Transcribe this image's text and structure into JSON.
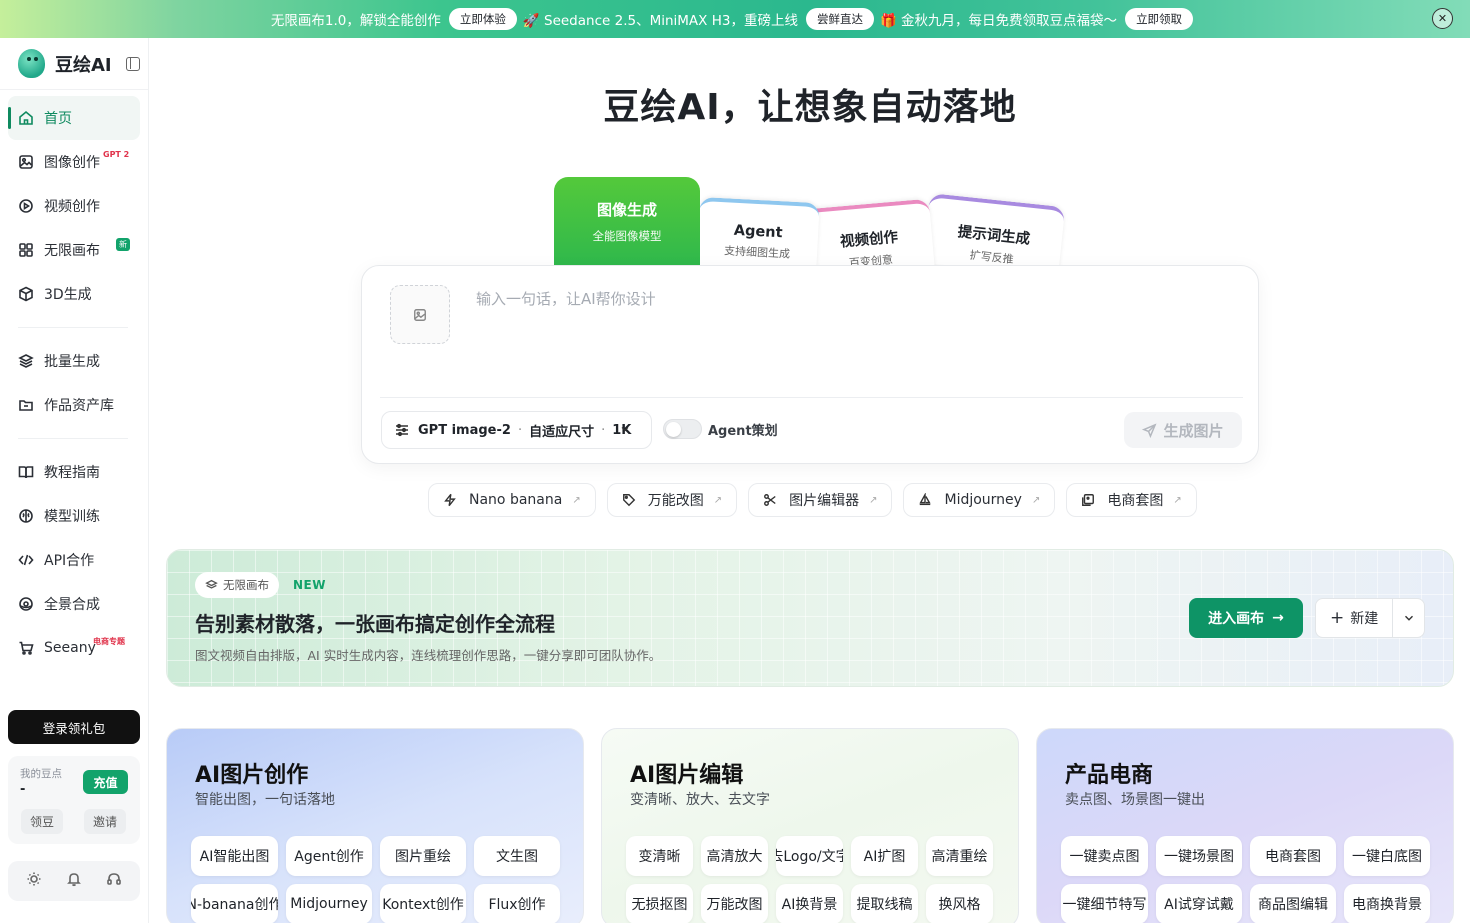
{
  "banner": {
    "seg1_text": "无限画布1.0，解锁全能创作",
    "seg1_btn": "立即体验",
    "seg2_text": "🚀 Seedance 2.5、MiniMAX H3，重磅上线",
    "seg2_btn": "尝鲜直达",
    "seg3_text": "🎁 金秋九月，每日免费领取豆点福袋～",
    "seg3_btn": "立即领取",
    "close_icon": "close-icon"
  },
  "sidebar": {
    "logo_text": "豆绘AI",
    "items": [
      {
        "label": "首页",
        "icon": "home-icon"
      },
      {
        "label": "图像创作",
        "icon": "image-icon",
        "tag": "GPT 2"
      },
      {
        "label": "视频创作",
        "icon": "play-icon"
      },
      {
        "label": "无限画布",
        "icon": "grid-icon",
        "tag": "新"
      },
      {
        "label": "3D生成",
        "icon": "cube-icon"
      },
      {
        "label": "批量生成",
        "icon": "layers-icon"
      },
      {
        "label": "作品资产库",
        "icon": "folder-icon"
      },
      {
        "label": "教程指南",
        "icon": "book-icon"
      },
      {
        "label": "模型训练",
        "icon": "brain-icon"
      },
      {
        "label": "API合作",
        "icon": "code-icon"
      },
      {
        "label": "全景合成",
        "icon": "panorama-icon"
      },
      {
        "label": "Seeany",
        "icon": "cart-icon",
        "tag": "电商专题"
      }
    ],
    "login_label": "登录领礼包",
    "points_label": "我的豆点",
    "points_value": "-",
    "recharge_label": "充值",
    "collect_label": "领豆",
    "invite_label": "邀请"
  },
  "hero": {
    "title": "豆绘AI，让想象自动落地"
  },
  "tabs": [
    {
      "title": "图像生成",
      "subtitle": "全能图像模型"
    },
    {
      "title": "Agent",
      "subtitle": "支持细图生成"
    },
    {
      "title": "视频创作",
      "subtitle": "百变创意"
    },
    {
      "title": "提示词生成",
      "subtitle": "扩写反推"
    }
  ],
  "composer": {
    "placeholder": "输入一句话，让AI帮你设计",
    "model": "GPT image-2",
    "size": "自适应尺寸",
    "resolution": "1K",
    "agent_label": "Agent策划",
    "generate_label": "生成图片"
  },
  "quick_tools": [
    {
      "label": "Nano banana",
      "icon": "lightning-icon"
    },
    {
      "label": "万能改图",
      "icon": "tag-icon"
    },
    {
      "label": "图片编辑器",
      "icon": "scissors-icon"
    },
    {
      "label": "Midjourney",
      "icon": "boat-icon"
    },
    {
      "label": "电商套图",
      "icon": "gallery-icon"
    }
  ],
  "canvas_banner": {
    "chip": "无限画布",
    "new_tag": "NEW",
    "title": "告别素材散落，一张画布搞定创作全流程",
    "desc": "图文视频自由排版，AI 实时生成内容，连线梳理创作思路，一键分享即可团队协作。",
    "enter_label": "进入画布",
    "new_label": "新建"
  },
  "feature_cards": [
    {
      "title": "AI图片创作",
      "subtitle": "智能出图，一句话落地",
      "row1": [
        "AI智能出图",
        "Agent创作",
        "图片重绘",
        "文生图"
      ],
      "row2": [
        "N-banana创作",
        "Midjourney",
        "Kontext创作",
        "Flux创作"
      ]
    },
    {
      "title": "AI图片编辑",
      "subtitle": "变清晰、放大、去文字",
      "row1": [
        "变清晰",
        "高清放大",
        "去Logo/文字",
        "AI扩图",
        "高清重绘"
      ],
      "row2": [
        "无损抠图",
        "万能改图",
        "AI换背景",
        "提取线稿",
        "换风格"
      ]
    },
    {
      "title": "产品电商",
      "subtitle": "卖点图、场景图一键出",
      "row1": [
        "一键卖点图",
        "一键场景图",
        "电商套图",
        "一键白底图"
      ],
      "row2": [
        "一键细节特写",
        "AI试穿试戴",
        "商品图编辑",
        "电商换背景"
      ]
    }
  ],
  "colors": {
    "accent": "#0e9466",
    "active_tab": "#3fbf47"
  }
}
